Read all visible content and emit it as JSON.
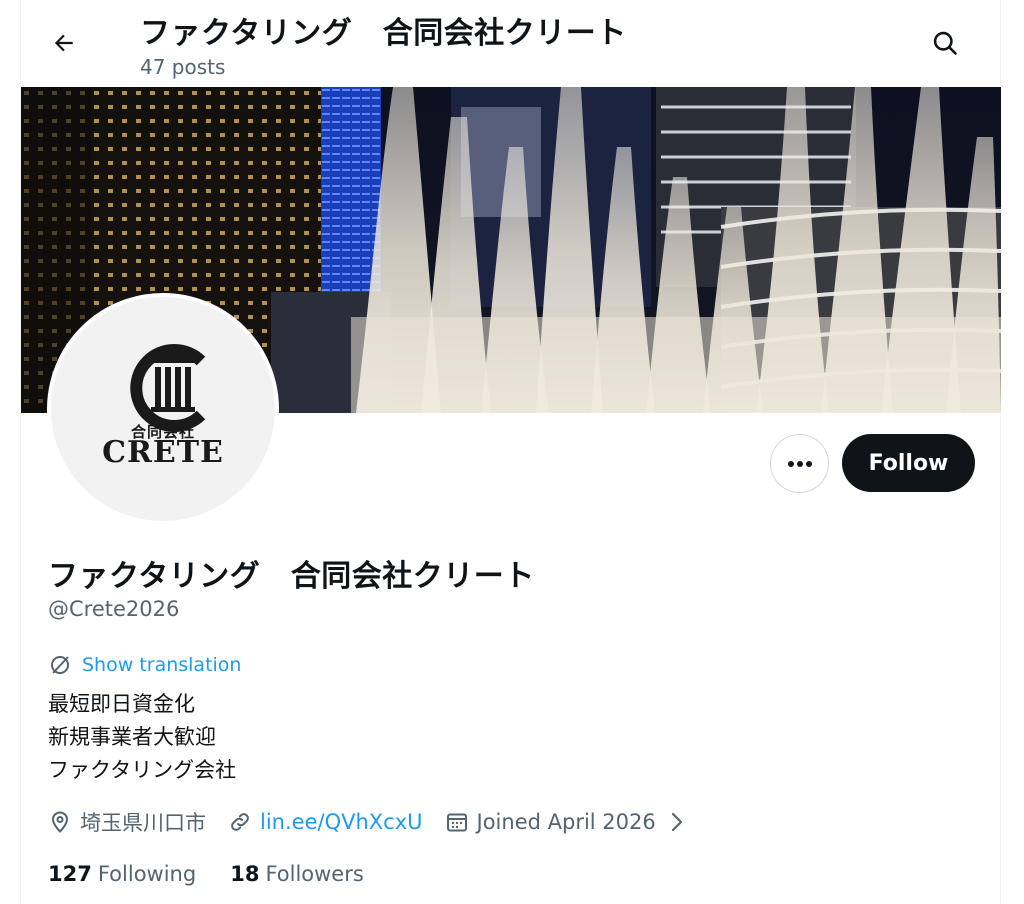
{
  "header": {
    "title": "ファクタリング　合同会社クリート",
    "posts_count": "47 posts"
  },
  "avatar": {
    "logo_text_jp": "合同会社",
    "logo_text_en": "CRETE"
  },
  "actions": {
    "follow_label": "Follow"
  },
  "profile": {
    "display_name": "ファクタリング　合同会社クリート",
    "handle": "@Crete2026",
    "translate_label": "Show translation",
    "bio_lines": [
      "最短即日資金化",
      "新規事業者大歓迎",
      "ファクタリング会社"
    ],
    "location": "埼玉県川口市",
    "link": "lin.ee/QVhXcxU",
    "joined": "Joined April 2026"
  },
  "stats": {
    "following_count": "127",
    "following_label": "Following",
    "followers_count": "18",
    "followers_label": "Followers"
  },
  "colors": {
    "accent": "#1d9bf0",
    "text_primary": "#0f1419",
    "text_secondary": "#536471",
    "follow_button_bg": "#0f1419"
  }
}
